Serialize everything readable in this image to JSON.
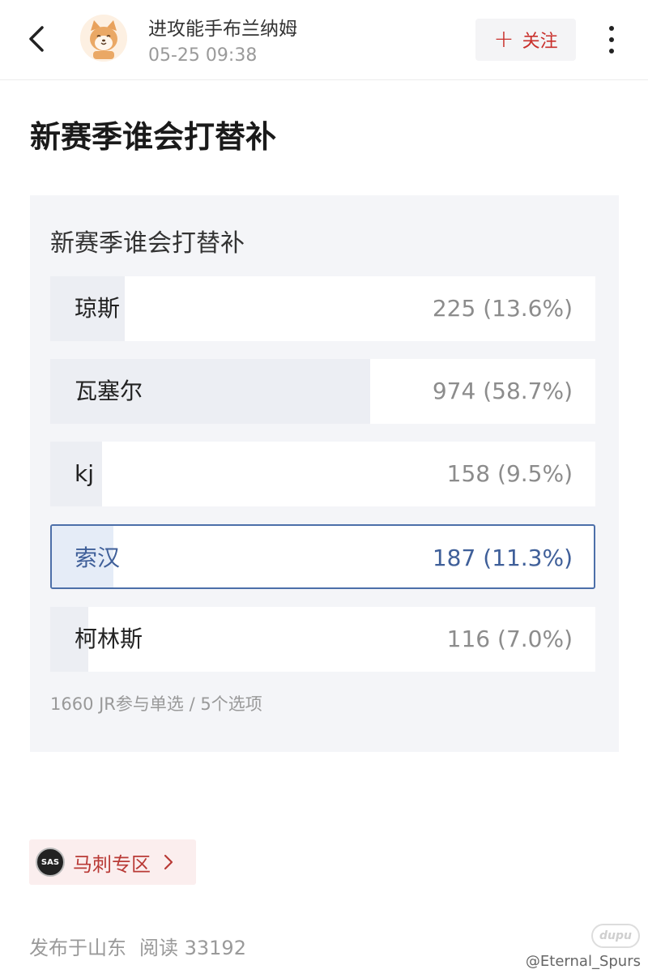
{
  "header": {
    "author_name": "进攻能手布兰纳姆",
    "post_time": "05-25 09:38",
    "follow_label": "关注",
    "follow_icon": "plus-icon",
    "back_icon": "chevron-left-icon",
    "more_icon": "more-vertical-icon"
  },
  "post": {
    "title": "新赛季谁会打替补"
  },
  "poll": {
    "title": "新赛季谁会打替补",
    "options": [
      {
        "name": "琼斯",
        "stat": "225 (13.6%)",
        "percent": 13.6,
        "selected": false
      },
      {
        "name": "瓦塞尔",
        "stat": "974 (58.7%)",
        "percent": 58.7,
        "selected": false
      },
      {
        "name": "kj",
        "stat": "158 (9.5%)",
        "percent": 9.5,
        "selected": false
      },
      {
        "name": "索汉",
        "stat": "187 (11.3%)",
        "percent": 11.3,
        "selected": true
      },
      {
        "name": "柯林斯",
        "stat": "116 (7.0%)",
        "percent": 7.0,
        "selected": false
      }
    ],
    "footer": "1660 JR参与单选 / 5个选项"
  },
  "zone": {
    "logo_text": "SAS",
    "label": "马刺专区",
    "arrow_icon": "chevron-right-icon"
  },
  "meta": {
    "location": "发布于山东",
    "reads": "阅读 33192"
  },
  "watermark": {
    "logo": "dupu",
    "text": "@Eternal_Spurs"
  },
  "colors": {
    "accent_red": "#c9302c",
    "selected_blue": "#3f5f99",
    "zone_bg": "#fbeeee"
  }
}
